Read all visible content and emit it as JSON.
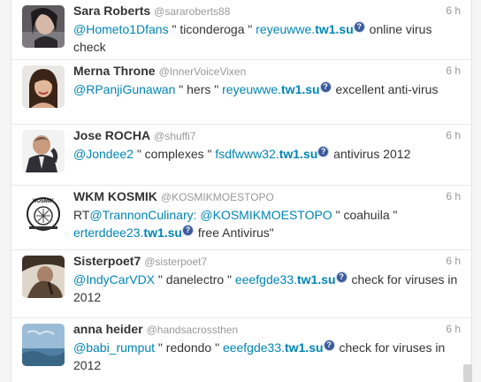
{
  "timeline": {
    "tweets": [
      {
        "name": "Sara Roberts",
        "handle": "@sararoberts88",
        "time": "6 h",
        "mention": "@Hometo1Dfans",
        "t1": " \" ticonderoga \" ",
        "link_pre": "reyeuwwe.",
        "link_dom": "tw1.su",
        "t2": " online virus check"
      },
      {
        "name": "Merna Throne",
        "handle": "@InnerVoiceVixen",
        "time": "6 h",
        "mention": "@RPanjiGunawan",
        "t1": " \" hers \" ",
        "link_pre": "reyeuwwe.",
        "link_dom": "tw1.su",
        "t2": " excellent anti-virus"
      },
      {
        "name": "Jose ROCHA",
        "handle": "@shuffi7",
        "time": "6 h",
        "mention": "@Jondee2",
        "t1": " \" complexes \" ",
        "link_pre": "fsdfwww32.",
        "link_dom": "tw1.su",
        "t2": " antivirus 2012"
      },
      {
        "name": "WKM KOSMIK",
        "handle": "@KOSMIKMOESTOPO",
        "time": "6 h",
        "rt": "RT",
        "rt_mention": "@TrannonCulinary:",
        "mention": "@KOSMIKMOESTOPO",
        "t1": " \" coahuila \" ",
        "link_pre": "erterddee23.",
        "link_dom": "tw1.su",
        "t2": " free Antivirus\"",
        "logo_text": "KOSMIK"
      },
      {
        "name": "Sisterpoet7",
        "handle": "@sisterpoet7",
        "time": "6 h",
        "mention": "@IndyCarVDX",
        "t1": " \" danelectro \" ",
        "link_pre": "eeefgde33.",
        "link_dom": "tw1.su",
        "t2": " check for viruses in 2012"
      },
      {
        "name": "anna heider",
        "handle": "@handsacrossthen",
        "time": "6 h",
        "mention": "@babi_rumput",
        "t1": " \" redondo \" ",
        "link_pre": "eeefgde33.",
        "link_dom": "tw1.su",
        "t2": " check for viruses in 2012"
      }
    ]
  },
  "colors": {
    "link": "#0084b4",
    "text": "#333333",
    "muted": "#999999",
    "badge": "#3b5b9a"
  },
  "icons": {
    "link_badge": "question-badge-icon"
  }
}
